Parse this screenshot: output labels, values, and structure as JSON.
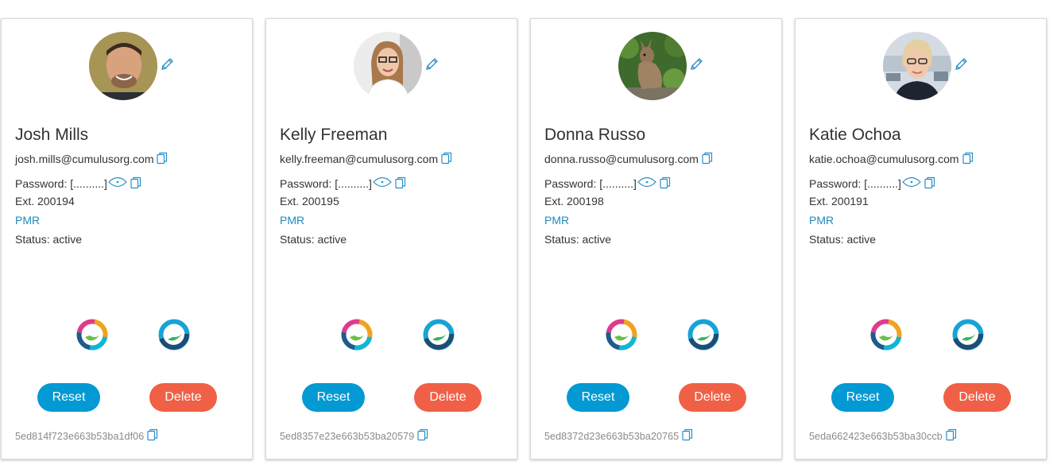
{
  "colors": {
    "accent_blue": "#0399d3",
    "delete_red": "#f06046",
    "link_blue": "#1f8ac0",
    "icon_blue": "#2a8fc7"
  },
  "users": [
    {
      "name": "Josh Mills",
      "email": "josh.mills@cumulusorg.com",
      "password": "Password: [..........]",
      "ext": "Ext. 200194",
      "pmr": "PMR",
      "status": "Status: active",
      "reset_label": "Reset",
      "delete_label": "Delete",
      "id": "5ed814f723e663b53ba1df06",
      "avatar": "man-smiling-photo"
    },
    {
      "name": "Kelly Freeman",
      "email": "kelly.freeman@cumulusorg.com",
      "password": "Password: [..........]",
      "ext": "Ext. 200195",
      "pmr": "PMR",
      "status": "Status: active",
      "reset_label": "Reset",
      "delete_label": "Delete",
      "id": "5ed8357e23e663b53ba20579",
      "avatar": "woman-glasses-photo"
    },
    {
      "name": "Donna Russo",
      "email": "donna.russo@cumulusorg.com",
      "password": "Password: [..........]",
      "ext": "Ext. 200198",
      "pmr": "PMR",
      "status": "Status: active",
      "reset_label": "Reset",
      "delete_label": "Delete",
      "id": "5ed8372d23e663b53ba20765",
      "avatar": "wallaby-photo"
    },
    {
      "name": "Katie Ochoa",
      "email": "katie.ochoa@cumulusorg.com",
      "password": "Password: [..........]",
      "ext": "Ext. 200191",
      "pmr": "PMR",
      "status": "Status: active",
      "reset_label": "Reset",
      "delete_label": "Delete",
      "id": "5eda662423e663b53ba30ccb",
      "avatar": "woman-short-hair-photo"
    }
  ]
}
